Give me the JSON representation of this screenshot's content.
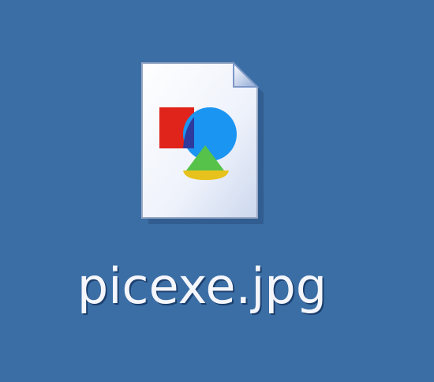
{
  "desktop": {
    "background_color": "#3b6ea5",
    "icons": [
      {
        "label": "picexe.jpg",
        "icon": "jpeg-image-file-icon",
        "selected": false
      }
    ]
  }
}
